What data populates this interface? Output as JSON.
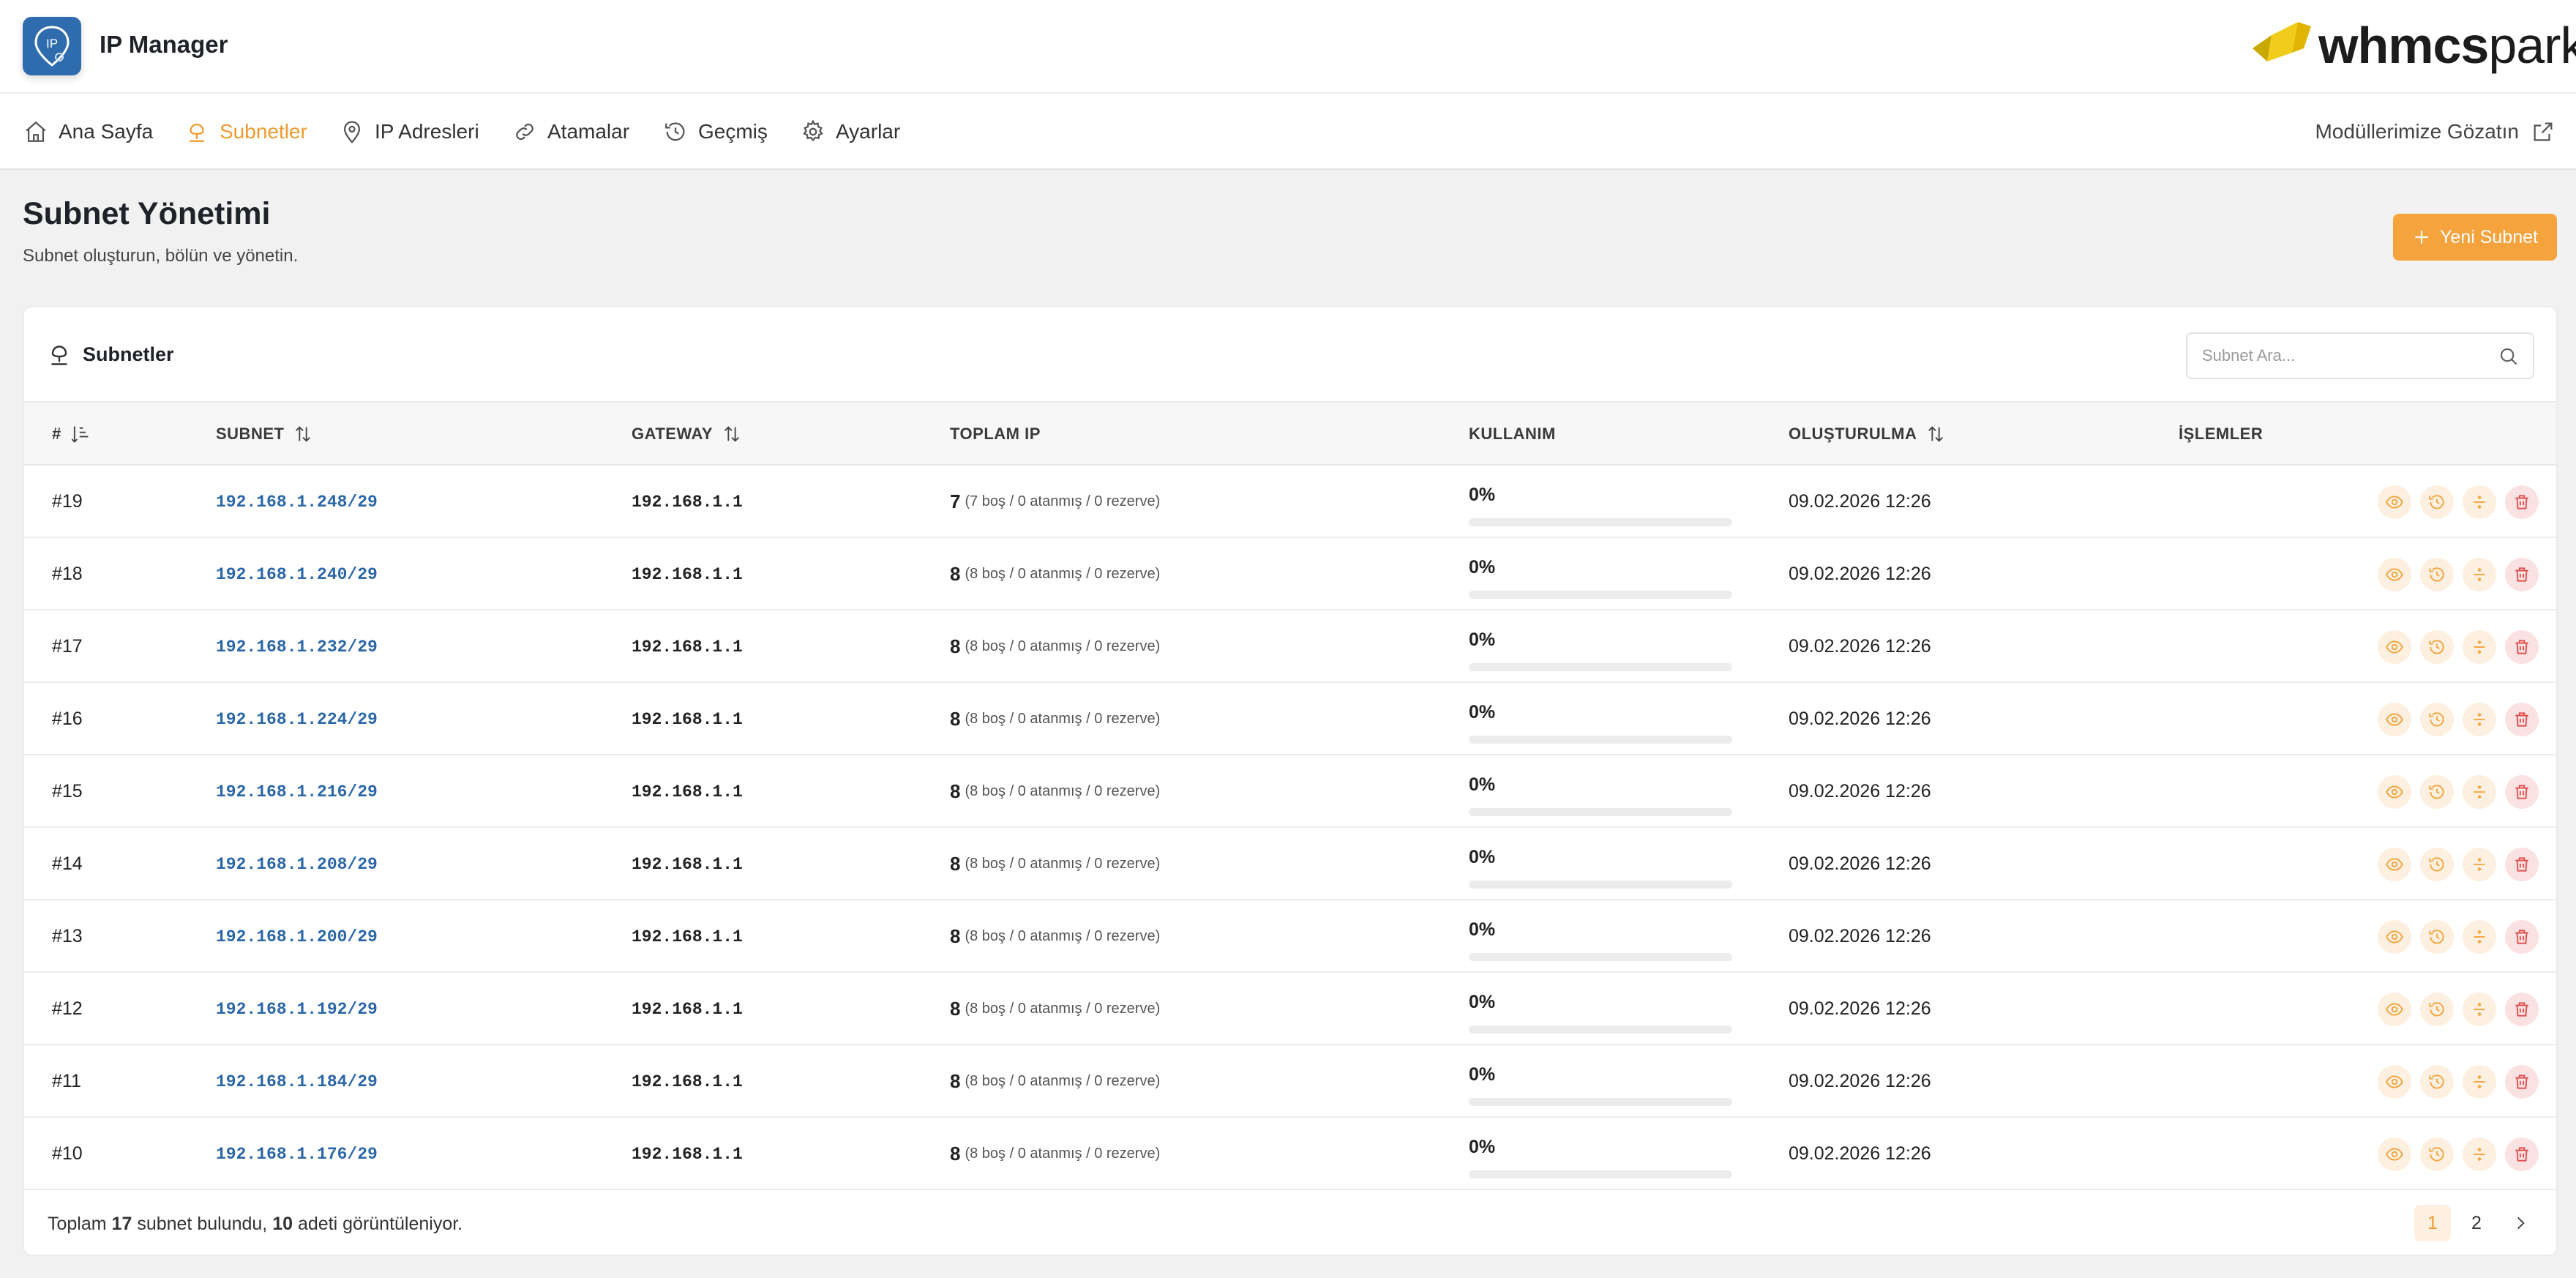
{
  "app": {
    "title": "IP Manager",
    "logo_label": "IP"
  },
  "brand": {
    "bold": "whmcs",
    "light": "park"
  },
  "nav": {
    "items": [
      {
        "label": "Ana Sayfa",
        "icon": "home-icon"
      },
      {
        "label": "Subnetler",
        "icon": "subnet-icon",
        "active": true
      },
      {
        "label": "IP Adresleri",
        "icon": "map-pin-icon"
      },
      {
        "label": "Atamalar",
        "icon": "link-icon"
      },
      {
        "label": "Geçmiş",
        "icon": "history-icon"
      },
      {
        "label": "Ayarlar",
        "icon": "gear-icon"
      }
    ],
    "external_label": "Modüllerimize Gözatın"
  },
  "page": {
    "title": "Subnet Yönetimi",
    "subtitle": "Subnet oluşturun, bölün ve yönetin.",
    "new_button": "Yeni Subnet"
  },
  "card": {
    "title": "Subnetler",
    "search_placeholder": "Subnet Ara..."
  },
  "table": {
    "headers": {
      "id": "#",
      "subnet": "SUBNET",
      "gateway": "GATEWAY",
      "total": "TOPLAM IP",
      "usage": "KULLANIM",
      "created": "OLUŞTURULMA",
      "actions": "İŞLEMLER"
    },
    "rows": [
      {
        "id": "#19",
        "subnet": "192.168.1.248/29",
        "gateway": "192.168.1.1",
        "total": "7",
        "detail": "(7 boş / 0 atanmış / 0 rezerve)",
        "usage": "0%",
        "usage_value": 0,
        "created": "09.02.2026 12:26"
      },
      {
        "id": "#18",
        "subnet": "192.168.1.240/29",
        "gateway": "192.168.1.1",
        "total": "8",
        "detail": "(8 boş / 0 atanmış / 0 rezerve)",
        "usage": "0%",
        "usage_value": 0,
        "created": "09.02.2026 12:26"
      },
      {
        "id": "#17",
        "subnet": "192.168.1.232/29",
        "gateway": "192.168.1.1",
        "total": "8",
        "detail": "(8 boş / 0 atanmış / 0 rezerve)",
        "usage": "0%",
        "usage_value": 0,
        "created": "09.02.2026 12:26"
      },
      {
        "id": "#16",
        "subnet": "192.168.1.224/29",
        "gateway": "192.168.1.1",
        "total": "8",
        "detail": "(8 boş / 0 atanmış / 0 rezerve)",
        "usage": "0%",
        "usage_value": 0,
        "created": "09.02.2026 12:26"
      },
      {
        "id": "#15",
        "subnet": "192.168.1.216/29",
        "gateway": "192.168.1.1",
        "total": "8",
        "detail": "(8 boş / 0 atanmış / 0 rezerve)",
        "usage": "0%",
        "usage_value": 0,
        "created": "09.02.2026 12:26"
      },
      {
        "id": "#14",
        "subnet": "192.168.1.208/29",
        "gateway": "192.168.1.1",
        "total": "8",
        "detail": "(8 boş / 0 atanmış / 0 rezerve)",
        "usage": "0%",
        "usage_value": 0,
        "created": "09.02.2026 12:26"
      },
      {
        "id": "#13",
        "subnet": "192.168.1.200/29",
        "gateway": "192.168.1.1",
        "total": "8",
        "detail": "(8 boş / 0 atanmış / 0 rezerve)",
        "usage": "0%",
        "usage_value": 0,
        "created": "09.02.2026 12:26"
      },
      {
        "id": "#12",
        "subnet": "192.168.1.192/29",
        "gateway": "192.168.1.1",
        "total": "8",
        "detail": "(8 boş / 0 atanmış / 0 rezerve)",
        "usage": "0%",
        "usage_value": 0,
        "created": "09.02.2026 12:26"
      },
      {
        "id": "#11",
        "subnet": "192.168.1.184/29",
        "gateway": "192.168.1.1",
        "total": "8",
        "detail": "(8 boş / 0 atanmış / 0 rezerve)",
        "usage": "0%",
        "usage_value": 0,
        "created": "09.02.2026 12:26"
      },
      {
        "id": "#10",
        "subnet": "192.168.1.176/29",
        "gateway": "192.168.1.1",
        "total": "8",
        "detail": "(8 boş / 0 atanmış / 0 rezerve)",
        "usage": "0%",
        "usage_value": 0,
        "created": "09.02.2026 12:26"
      }
    ],
    "row_actions": [
      "eye-icon",
      "history-icon",
      "divide-icon",
      "trash-icon"
    ]
  },
  "footer": {
    "prefix": "Toplam",
    "total": "17",
    "middle": "subnet bulundu,",
    "shown": "10",
    "suffix": "adeti görüntüleniyor."
  },
  "pagination": {
    "pages": [
      "1",
      "2"
    ],
    "current": "1"
  },
  "colors": {
    "accent": "#f5a33d",
    "link": "#2a66a8",
    "danger": "#e04b4b",
    "logo_bg": "#2f6cad"
  }
}
